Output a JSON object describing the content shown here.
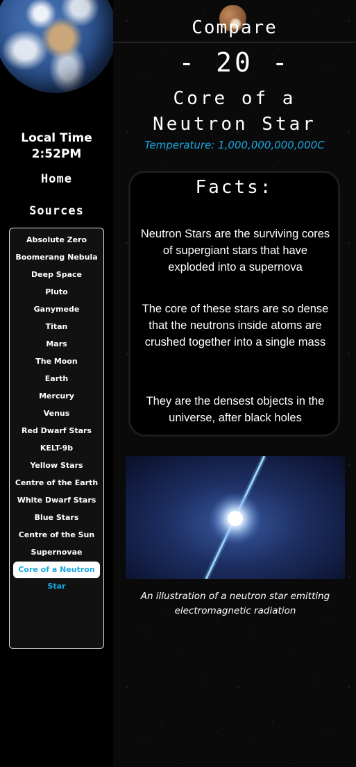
{
  "sidebar": {
    "local_time_label": "Local Time",
    "local_time_value": "2:52PM",
    "home_label": "Home",
    "sources_label": "Sources",
    "items": [
      {
        "label": "Absolute Zero"
      },
      {
        "label": "Boomerang Nebula"
      },
      {
        "label": "Deep Space"
      },
      {
        "label": "Pluto"
      },
      {
        "label": "Ganymede"
      },
      {
        "label": "Titan"
      },
      {
        "label": "Mars"
      },
      {
        "label": "The Moon"
      },
      {
        "label": "Earth"
      },
      {
        "label": "Mercury"
      },
      {
        "label": "Venus"
      },
      {
        "label": "Red Dwarf Stars"
      },
      {
        "label": "KELT-9b"
      },
      {
        "label": "Yellow Stars"
      },
      {
        "label": "Centre of the Earth"
      },
      {
        "label": "White Dwarf Stars"
      },
      {
        "label": "Blue Stars"
      },
      {
        "label": "Centre of the Sun"
      },
      {
        "label": "Supernovae"
      },
      {
        "label": "Core of a Neutron Star",
        "active": true
      }
    ]
  },
  "header": {
    "compare_label": "Compare",
    "number": "- 20 -"
  },
  "main": {
    "title_line1": "Core of a",
    "title_line2": "Neutron Star",
    "temperature": "Temperature: 1,000,000,000,000C",
    "facts_title": "Facts:",
    "facts": [
      "Neutron Stars are the surviving cores of supergiant stars that have exploded into a supernova",
      "The core of these stars are so dense that the neutrons inside atoms are crushed together into a single mass",
      "They are the densest objects in the universe, after black holes"
    ],
    "caption": "An illustration of a neutron star emitting electromagnetic radiation"
  },
  "colors": {
    "accent": "#1aa7e0",
    "background": "#000000",
    "panel_border": "#1c1c1c"
  },
  "icons": {
    "earth": "earth-image",
    "pluto": "pluto-image"
  }
}
